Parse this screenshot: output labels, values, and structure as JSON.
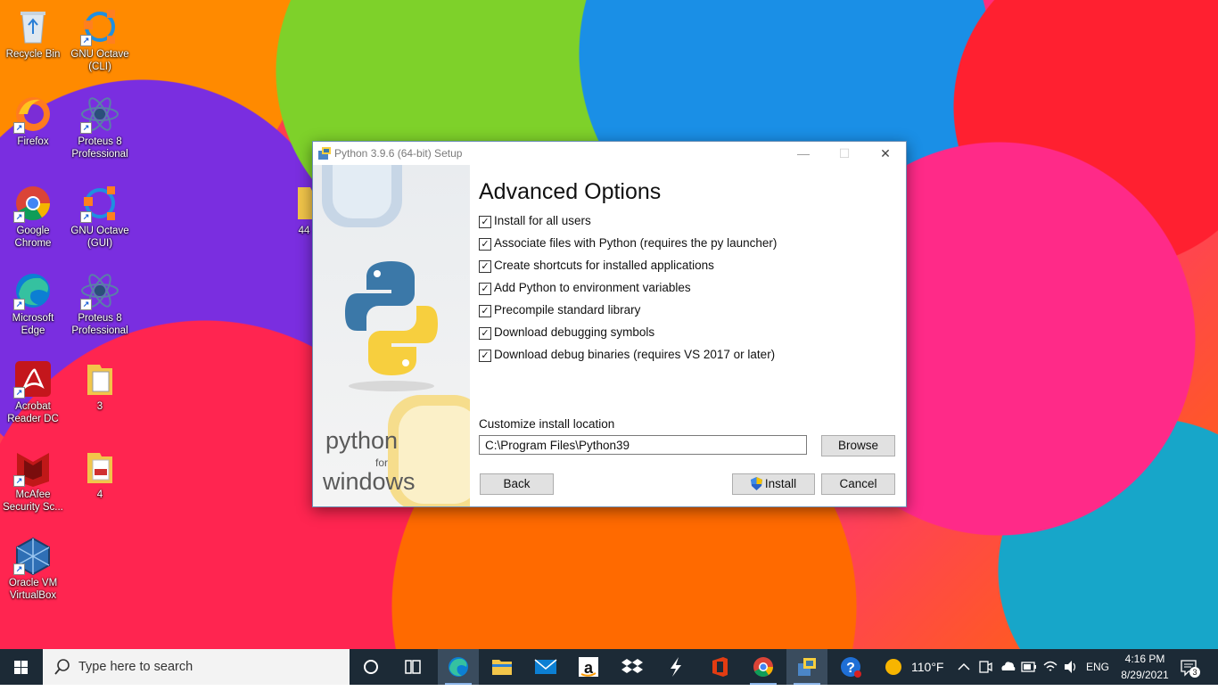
{
  "desktop": {
    "icons": [
      {
        "label": "Recycle Bin",
        "icon": "recycle-bin-icon"
      },
      {
        "label": "GNU Octave\n(CLI)",
        "icon": "octave-icon"
      },
      {
        "label": "Firefox",
        "icon": "firefox-icon"
      },
      {
        "label": "Proteus 8\nProfessional",
        "icon": "proteus-icon"
      },
      {
        "label": "Google\nChrome",
        "icon": "chrome-icon"
      },
      {
        "label": "GNU Octave\n(GUI)",
        "icon": "octave-icon"
      },
      {
        "label": "Microsoft\nEdge",
        "icon": "edge-icon"
      },
      {
        "label": "Proteus 8\nProfessional",
        "icon": "proteus-icon"
      },
      {
        "label": "Acrobat\nReader DC",
        "icon": "acrobat-icon"
      },
      {
        "label": "3",
        "icon": "folder-icon"
      },
      {
        "label": "McAfee\nSecurity Sc...",
        "icon": "mcafee-icon"
      },
      {
        "label": "4",
        "icon": "pdf-file-icon"
      },
      {
        "label": "Oracle VM\nVirtualBox",
        "icon": "virtualbox-icon"
      },
      {
        "label": "44",
        "icon": "folder-icon"
      }
    ]
  },
  "dialog": {
    "title": "Python 3.9.6 (64-bit) Setup",
    "minimize": "—",
    "maximize": "☐",
    "close": "✕",
    "brand_python": "python",
    "brand_for": "for",
    "brand_windows": "windows",
    "heading": "Advanced Options",
    "options": [
      {
        "label": "Install for all users",
        "checked": true
      },
      {
        "label": "Associate files with Python (requires the py launcher)",
        "checked": true
      },
      {
        "label": "Create shortcuts for installed applications",
        "checked": true
      },
      {
        "label": "Add Python to environment variables",
        "checked": true
      },
      {
        "label": "Precompile standard library",
        "checked": true
      },
      {
        "label": "Download debugging symbols",
        "checked": true
      },
      {
        "label": "Download debug binaries (requires VS 2017 or later)",
        "checked": true
      }
    ],
    "location_label": "Customize install location",
    "location_value": "C:\\Program Files\\Python39",
    "browse": "Browse",
    "back": "Back",
    "install": "Install",
    "cancel": "Cancel"
  },
  "taskbar": {
    "search_placeholder": "Type here to search",
    "weather_temp": "110°F",
    "language": "ENG",
    "time": "4:16 PM",
    "date": "8/29/2021",
    "notifications": "3"
  },
  "colors": {
    "taskbar_bg": "#1c2a36",
    "python_blue": "#3b78a8",
    "python_yellow": "#f7cf3e",
    "shield_blue": "#2a64c8"
  }
}
